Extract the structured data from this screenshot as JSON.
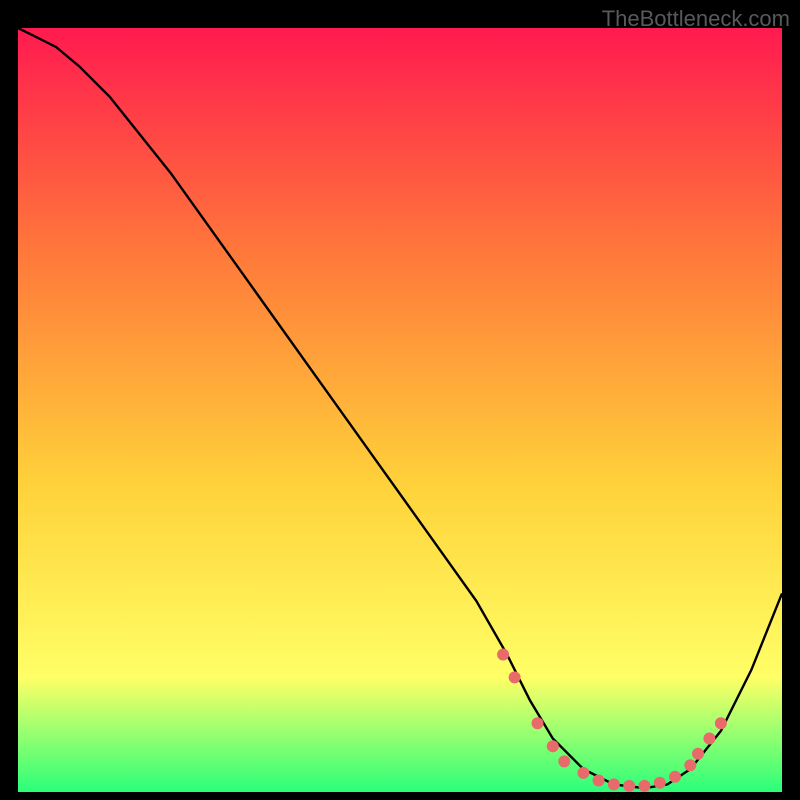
{
  "attribution": "TheBottleneck.com",
  "colors": {
    "gradient_top": "#ff1a4f",
    "gradient_mid1": "#ff7a3a",
    "gradient_mid2": "#ffd23a",
    "gradient_mid3": "#ffff66",
    "gradient_bottom": "#2aff7a",
    "curve": "#000000",
    "markers": "#e86a6a",
    "frame": "#000000"
  },
  "chart_data": {
    "type": "line",
    "title": "",
    "xlabel": "",
    "ylabel": "",
    "xlim": [
      0,
      100
    ],
    "ylim": [
      0,
      100
    ],
    "series": [
      {
        "name": "curve",
        "x": [
          0,
          2,
          5,
          8,
          12,
          20,
          30,
          40,
          50,
          60,
          64,
          67,
          70,
          74,
          78,
          82,
          85,
          88,
          92,
          96,
          100
        ],
        "y": [
          100,
          99,
          97.5,
          95,
          91,
          81,
          67,
          53,
          39,
          25,
          18,
          12,
          7,
          3,
          1,
          0.5,
          1,
          3,
          8,
          16,
          26
        ]
      }
    ],
    "markers": [
      {
        "x": 63.5,
        "y": 18
      },
      {
        "x": 65,
        "y": 15
      },
      {
        "x": 68,
        "y": 9
      },
      {
        "x": 70,
        "y": 6
      },
      {
        "x": 71.5,
        "y": 4
      },
      {
        "x": 74,
        "y": 2.5
      },
      {
        "x": 76,
        "y": 1.5
      },
      {
        "x": 78,
        "y": 1
      },
      {
        "x": 80,
        "y": 0.8
      },
      {
        "x": 82,
        "y": 0.8
      },
      {
        "x": 84,
        "y": 1.2
      },
      {
        "x": 86,
        "y": 2
      },
      {
        "x": 88,
        "y": 3.5
      },
      {
        "x": 89,
        "y": 5
      },
      {
        "x": 90.5,
        "y": 7
      },
      {
        "x": 92,
        "y": 9
      }
    ]
  }
}
